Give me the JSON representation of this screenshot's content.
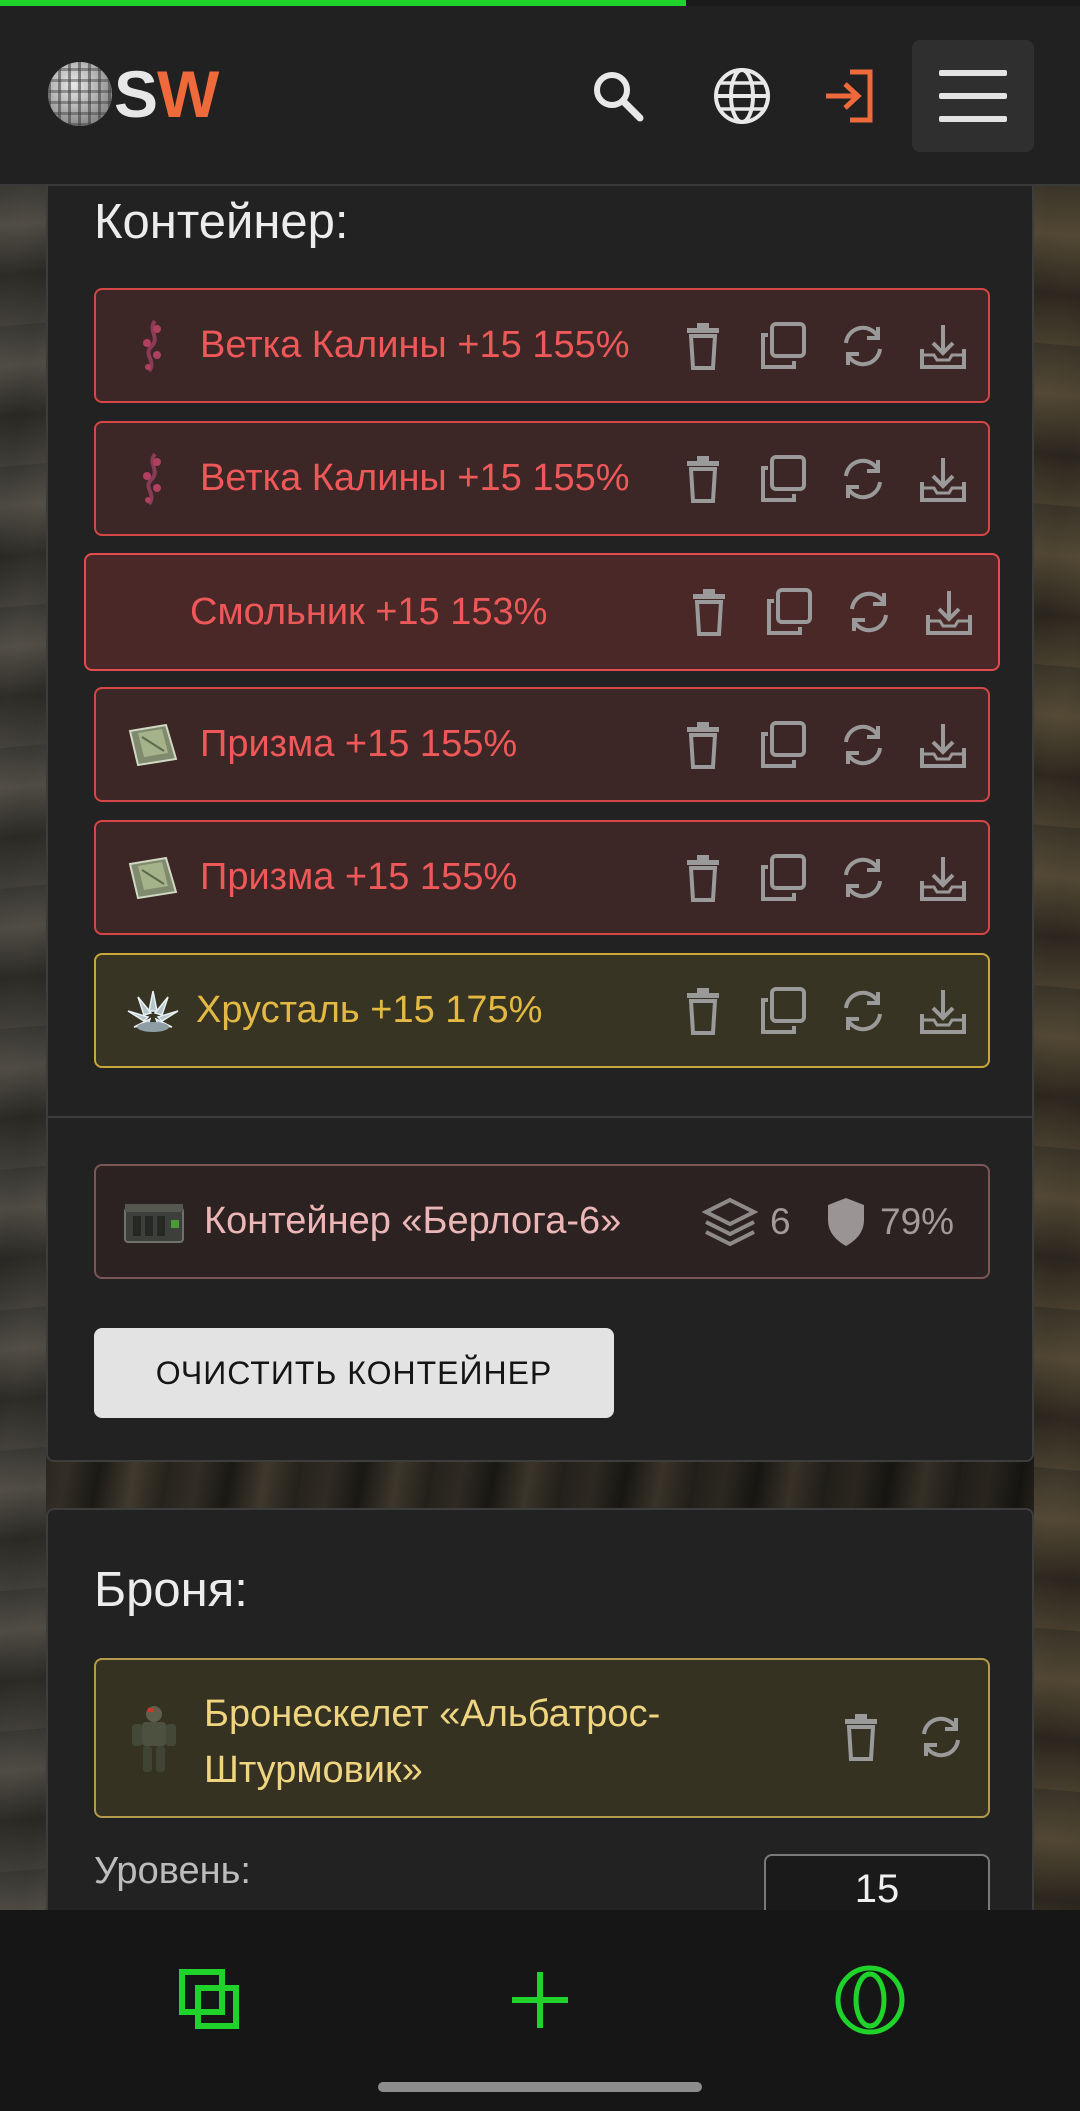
{
  "progress": {
    "fraction": 0.635,
    "color": "#1fd32a"
  },
  "header": {
    "logo_s": "S",
    "logo_w": "W",
    "icons": [
      "search-icon",
      "globe-icon",
      "login-icon",
      "menu-icon"
    ]
  },
  "container_section": {
    "title": "Контейнер:",
    "items": [
      {
        "name": "Ветка Калины +15 155%",
        "rarity": "red",
        "icon": "viburnum-branch-icon"
      },
      {
        "name": "Ветка Калины +15 155%",
        "rarity": "red",
        "icon": "viburnum-branch-icon"
      },
      {
        "name": "Смольник +15 153%",
        "rarity": "red",
        "icon": "none"
      },
      {
        "name": "Призма +15 155%",
        "rarity": "red",
        "icon": "prism-icon"
      },
      {
        "name": "Призма +15 155%",
        "rarity": "red",
        "icon": "prism-icon"
      },
      {
        "name": "Хрусталь +15 175%",
        "rarity": "gold",
        "icon": "crystal-icon"
      }
    ],
    "container": {
      "name": "Контейнер «Берлога-6»",
      "slots": "6",
      "protection": "79%"
    },
    "clear_button": "ОЧИСТИТЬ КОНТЕЙНЕР"
  },
  "armor_section": {
    "title": "Броня:",
    "item": {
      "name": "Бронескелет «Альбатрос-Штурмовик»"
    },
    "level_label": "Уровень:",
    "level_value": "15"
  },
  "colors": {
    "accent_green": "#1fd32a",
    "logo_orange": "#ef6a3b",
    "red_item": "#ee5858",
    "gold_item": "#e3b944"
  }
}
